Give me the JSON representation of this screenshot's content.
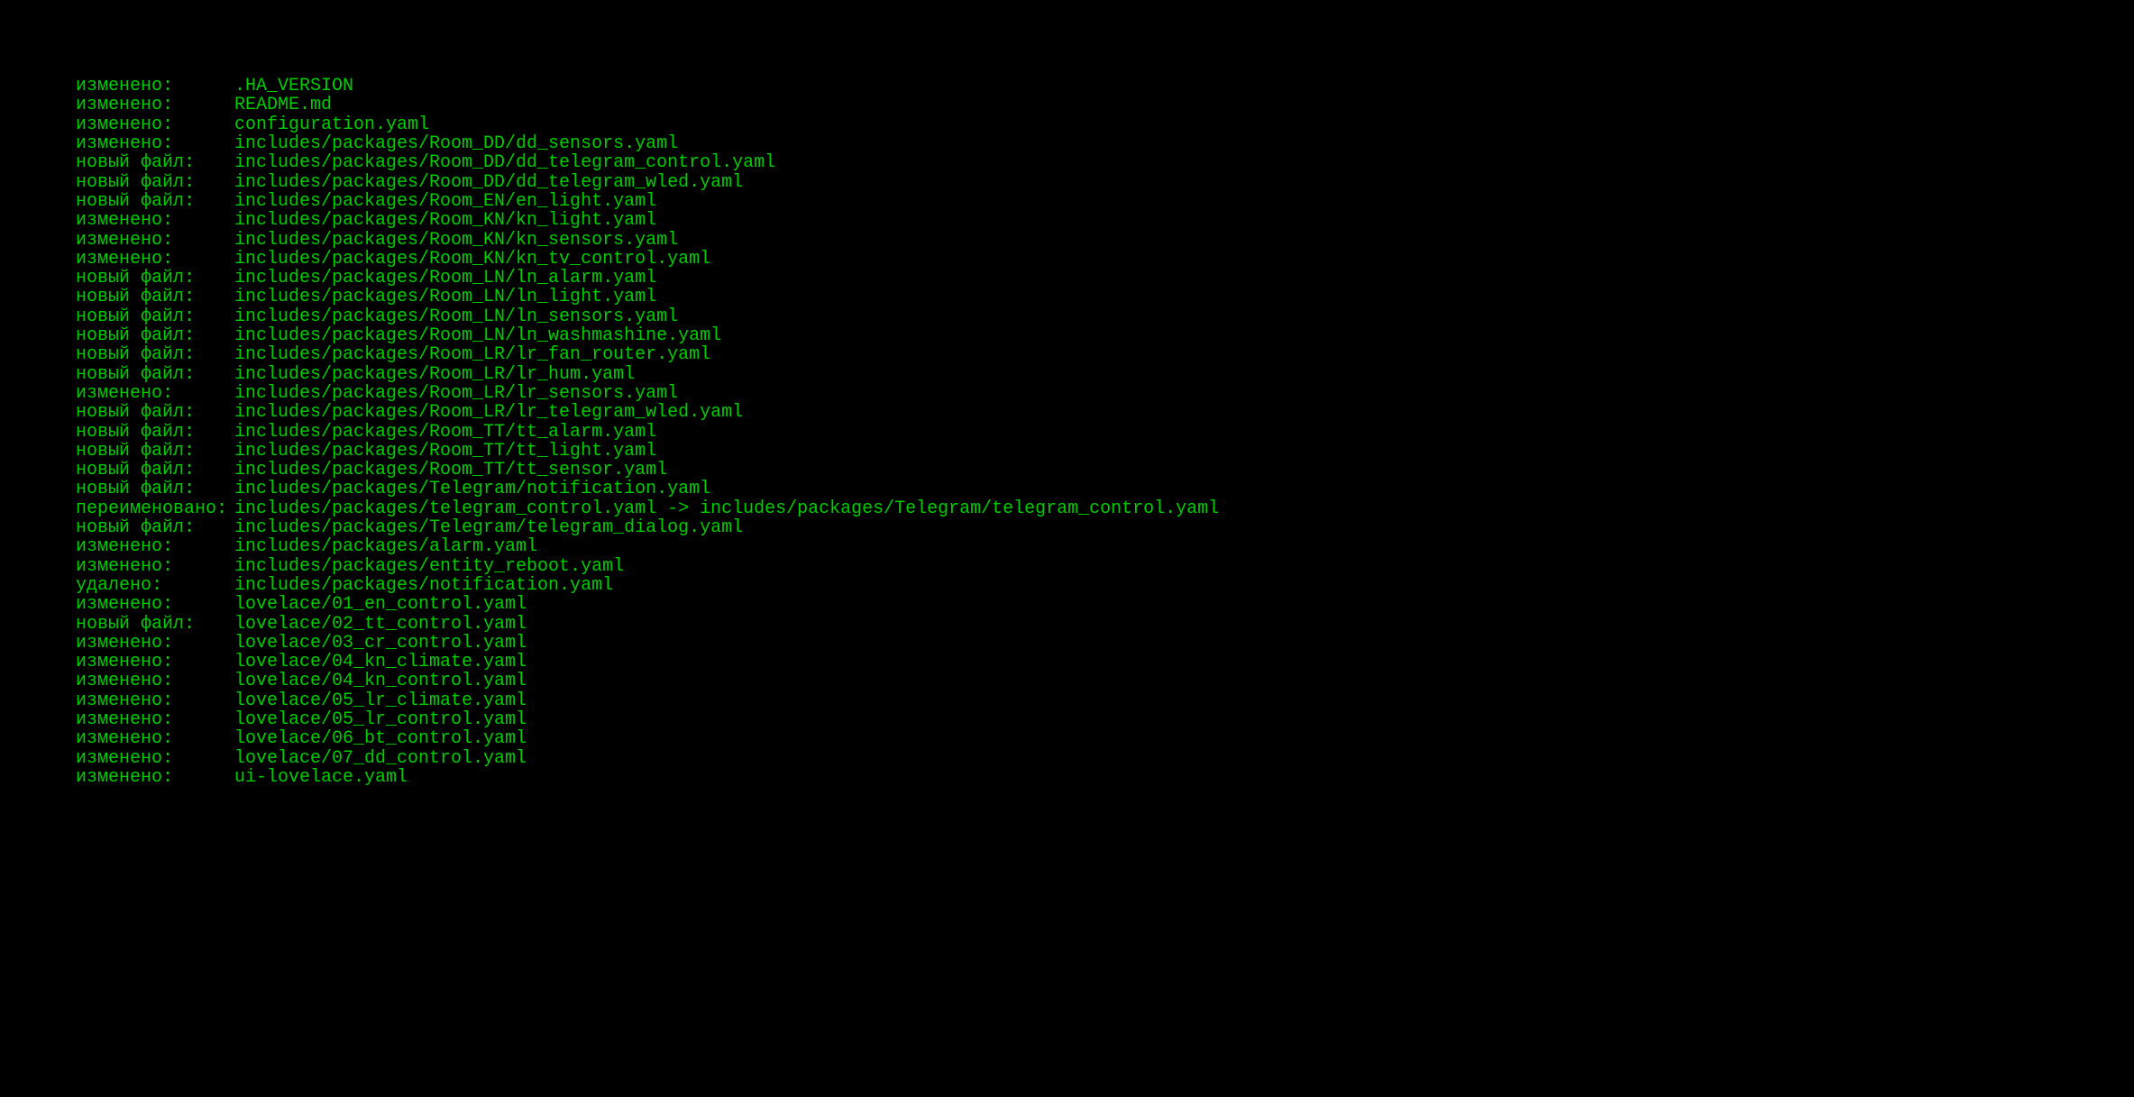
{
  "terminal": {
    "entries": [
      {
        "status": "изменено:",
        "path": ".HA_VERSION"
      },
      {
        "status": "изменено:",
        "path": "README.md"
      },
      {
        "status": "изменено:",
        "path": "configuration.yaml"
      },
      {
        "status": "изменено:",
        "path": "includes/packages/Room_DD/dd_sensors.yaml"
      },
      {
        "status": "новый файл:",
        "path": "includes/packages/Room_DD/dd_telegram_control.yaml"
      },
      {
        "status": "новый файл:",
        "path": "includes/packages/Room_DD/dd_telegram_wled.yaml"
      },
      {
        "status": "новый файл:",
        "path": "includes/packages/Room_EN/en_light.yaml"
      },
      {
        "status": "изменено:",
        "path": "includes/packages/Room_KN/kn_light.yaml"
      },
      {
        "status": "изменено:",
        "path": "includes/packages/Room_KN/kn_sensors.yaml"
      },
      {
        "status": "изменено:",
        "path": "includes/packages/Room_KN/kn_tv_control.yaml"
      },
      {
        "status": "новый файл:",
        "path": "includes/packages/Room_LN/ln_alarm.yaml"
      },
      {
        "status": "новый файл:",
        "path": "includes/packages/Room_LN/ln_light.yaml"
      },
      {
        "status": "новый файл:",
        "path": "includes/packages/Room_LN/ln_sensors.yaml"
      },
      {
        "status": "новый файл:",
        "path": "includes/packages/Room_LN/ln_washmashine.yaml"
      },
      {
        "status": "новый файл:",
        "path": "includes/packages/Room_LR/lr_fan_router.yaml"
      },
      {
        "status": "новый файл:",
        "path": "includes/packages/Room_LR/lr_hum.yaml"
      },
      {
        "status": "изменено:",
        "path": "includes/packages/Room_LR/lr_sensors.yaml"
      },
      {
        "status": "новый файл:",
        "path": "includes/packages/Room_LR/lr_telegram_wled.yaml"
      },
      {
        "status": "новый файл:",
        "path": "includes/packages/Room_TT/tt_alarm.yaml"
      },
      {
        "status": "новый файл:",
        "path": "includes/packages/Room_TT/tt_light.yaml"
      },
      {
        "status": "новый файл:",
        "path": "includes/packages/Room_TT/tt_sensor.yaml"
      },
      {
        "status": "новый файл:",
        "path": "includes/packages/Telegram/notification.yaml"
      },
      {
        "status": "переименовано:",
        "path": "includes/packages/telegram_control.yaml -> includes/packages/Telegram/telegram_control.yaml"
      },
      {
        "status": "новый файл:",
        "path": "includes/packages/Telegram/telegram_dialog.yaml"
      },
      {
        "status": "изменено:",
        "path": "includes/packages/alarm.yaml"
      },
      {
        "status": "изменено:",
        "path": "includes/packages/entity_reboot.yaml"
      },
      {
        "status": "удалено:",
        "path": "includes/packages/notification.yaml"
      },
      {
        "status": "изменено:",
        "path": "lovelace/01_en_control.yaml"
      },
      {
        "status": "новый файл:",
        "path": "lovelace/02_tt_control.yaml"
      },
      {
        "status": "изменено:",
        "path": "lovelace/03_cr_control.yaml"
      },
      {
        "status": "изменено:",
        "path": "lovelace/04_kn_climate.yaml"
      },
      {
        "status": "изменено:",
        "path": "lovelace/04_kn_control.yaml"
      },
      {
        "status": "изменено:",
        "path": "lovelace/05_lr_climate.yaml"
      },
      {
        "status": "изменено:",
        "path": "lovelace/05_lr_control.yaml"
      },
      {
        "status": "изменено:",
        "path": "lovelace/06_bt_control.yaml"
      },
      {
        "status": "изменено:",
        "path": "lovelace/07_dd_control.yaml"
      },
      {
        "status": "изменено:",
        "path": "ui-lovelace.yaml"
      }
    ]
  }
}
